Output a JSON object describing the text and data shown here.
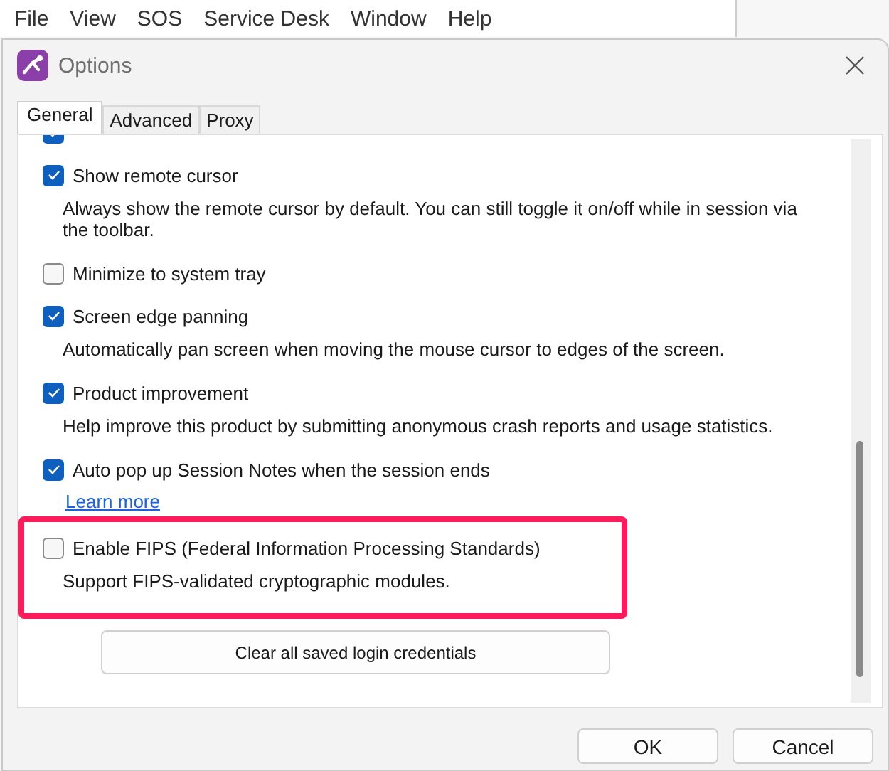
{
  "menu_bar": [
    "File",
    "View",
    "SOS",
    "Service Desk",
    "Window",
    "Help"
  ],
  "dialog": {
    "title": "Options"
  },
  "tabs": [
    {
      "label": "General",
      "selected": true
    },
    {
      "label": "Advanced",
      "selected": false
    },
    {
      "label": "Proxy",
      "selected": false
    }
  ],
  "settings": [
    {
      "checked": true,
      "highlighted": false
    },
    {
      "label": "Show remote cursor",
      "checked": true,
      "highlighted": false,
      "description": "Always show the remote cursor by default. You can still toggle it on/off while in session via the toolbar."
    },
    {
      "label": "Minimize to system tray",
      "checked": false,
      "highlighted": false
    },
    {
      "label": "Screen edge panning",
      "checked": true,
      "highlighted": false,
      "description": "Automatically pan screen when moving the mouse cursor to edges of the screen."
    },
    {
      "label": "Product improvement",
      "checked": true,
      "highlighted": false,
      "description": "Help improve this product by submitting anonymous crash reports and usage statistics."
    },
    {
      "label": "Auto pop up Session Notes when the session ends",
      "checked": true,
      "highlighted": false,
      "link": "Learn more"
    },
    {
      "label": "Enable FIPS (Federal Information Processing Standards)",
      "checked": false,
      "highlighted": true,
      "description": "Support FIPS-validated cryptographic modules."
    }
  ],
  "panel_button": "Clear all saved login credentials",
  "buttons": [
    "OK",
    "Cancel"
  ]
}
